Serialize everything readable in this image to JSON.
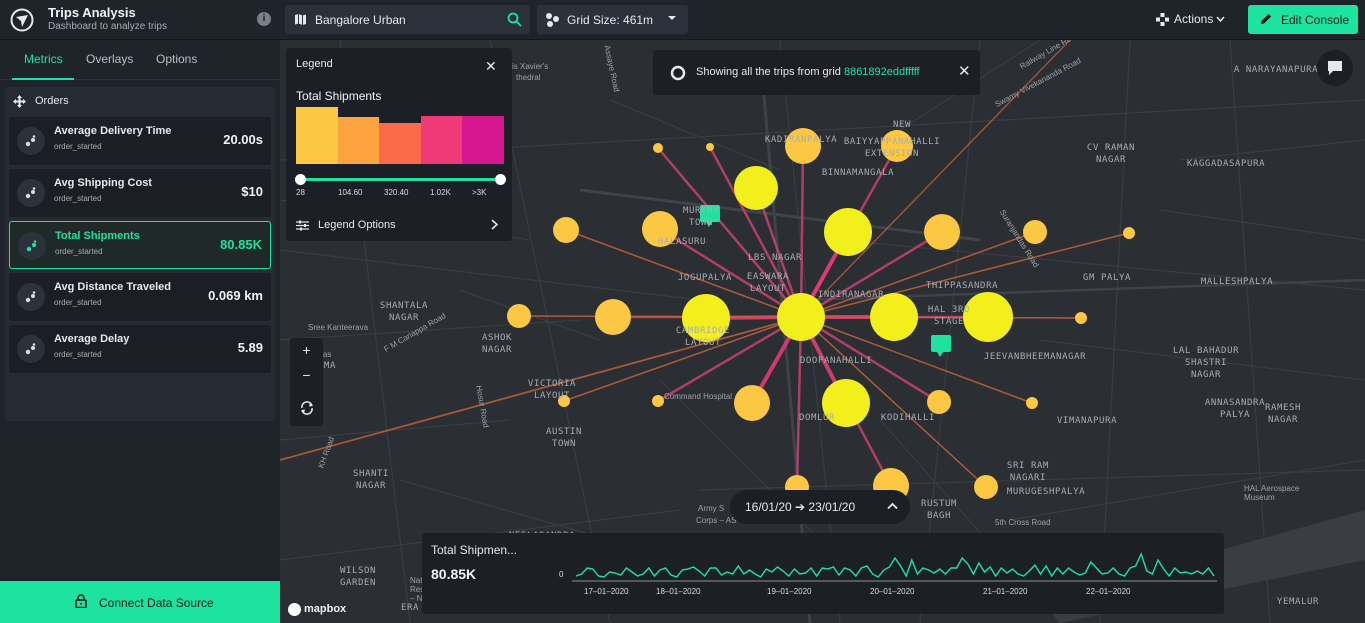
{
  "app": {
    "title": "Trips Analysis",
    "subtitle": "Dashboard to analyze trips",
    "info_icon": "info-icon"
  },
  "search": {
    "value": "Bangalore Urban",
    "placeholder": "Bangalore Urban"
  },
  "grid": {
    "label": "Grid Size: 461m"
  },
  "toolbar": {
    "actions_label": "Actions",
    "edit_console_label": "Edit Console"
  },
  "sidebar": {
    "tabs": [
      {
        "label": "Metrics",
        "active": true
      },
      {
        "label": "Overlays",
        "active": false
      },
      {
        "label": "Options",
        "active": false
      }
    ],
    "section_title": "Orders",
    "metrics": [
      {
        "name": "Average Delivery Time",
        "event": "order_started",
        "value": "20.00s",
        "active": false
      },
      {
        "name": "Avg Shipping Cost",
        "event": "order_started",
        "value": "$10",
        "active": false
      },
      {
        "name": "Total Shipments",
        "event": "order_started",
        "value": "80.85K",
        "active": true
      },
      {
        "name": "Avg Distance Traveled",
        "event": "order_started",
        "value": "0.069 km",
        "active": false
      },
      {
        "name": "Average Delay",
        "event": "order_started",
        "value": "5.89",
        "active": false
      }
    ],
    "connect_label": "Connect Data Source"
  },
  "legend": {
    "title": "Legend",
    "subtitle": "Total Shipments",
    "colors": [
      "#fcc742",
      "#fda33f",
      "#fb6a4a",
      "#f03a77",
      "#d6178f"
    ],
    "ticks": [
      "28",
      "104.60",
      "320.40",
      "1.02K",
      ">3K"
    ],
    "options_label": "Legend Options"
  },
  "banner": {
    "text": "Showing all the trips from grid ",
    "grid_id": "8861892eddfffff"
  },
  "date_range": "16/01/20 ➔ 23/01/20",
  "timeline": {
    "title": "Total Shipmen...",
    "value": "80.85K",
    "zero_label": "0",
    "ticks": [
      "17–01–2020",
      "18–01–2020",
      "19–01–2020",
      "20–01–2020",
      "21–01–2020",
      "22–01–2020"
    ]
  },
  "zoom": {
    "in": "+",
    "out": "−"
  },
  "attribution": "mapbox",
  "map": {
    "places": [
      {
        "t": "KADIRANPALYA"
      },
      {
        "t": "BAIYYAPPANAHALLI\nEXTENSION"
      },
      {
        "t": "NEW"
      },
      {
        "t": "BINNAMANGALA"
      },
      {
        "t": "CV RAMAN\nNAGAR"
      },
      {
        "t": "KAGGADASAPURA"
      },
      {
        "t": "A NARAYANAPURA"
      },
      {
        "t": "MURPHY\nTOWN"
      },
      {
        "t": "HALASURU"
      },
      {
        "t": "LBS NAGAR"
      },
      {
        "t": "JOGUPALYA"
      },
      {
        "t": "EASWARA\nLAYOUT"
      },
      {
        "t": "INDIRANAGAR"
      },
      {
        "t": "THIPPASANDRA"
      },
      {
        "t": "HAL 3RD\nSTAGE"
      },
      {
        "t": "GM PALYA"
      },
      {
        "t": "MALLESHPALYA"
      },
      {
        "t": "SHANTALA\nNAGAR"
      },
      {
        "t": "ASHOK\nNAGAR"
      },
      {
        "t": "CAMBRIDGE\nLAYOUT"
      },
      {
        "t": "DOOPANAHALLI"
      },
      {
        "t": "JEEVANBHEEMANAGAR"
      },
      {
        "t": "LAL BAHADUR\nSHASTRI\nNAGAR"
      },
      {
        "t": "VICTORIA\nLAYOUT"
      },
      {
        "t": "DOMLUR"
      },
      {
        "t": "KODIHALLI"
      },
      {
        "t": "VIMANAPURA"
      },
      {
        "t": "ANNASANDRA\nPALYA"
      },
      {
        "t": "RAMESH\nNAGAR"
      },
      {
        "t": "AUSTIN\nTOWN"
      },
      {
        "t": "SRI RAM\nNAGARI"
      },
      {
        "t": "MURUGESHPALYA"
      },
      {
        "t": "SHANTI\nNAGAR"
      },
      {
        "t": "RUSTUM\nBAGH"
      },
      {
        "t": "NEELASANDRA"
      },
      {
        "t": "WILSON\nGARDEN"
      },
      {
        "t": "YEMALUR"
      },
      {
        "t": "ERA"
      },
      {
        "t": "MAMA"
      }
    ],
    "roads": [
      "Assaye Road",
      "Railway Line Road",
      "Swamy Vivekananda Road",
      "Suranjandas Road",
      "Sree Kanteerava",
      "F M Cariappa Road",
      "Hosur Road",
      "KH Road",
      "Command Hospital",
      "Army S",
      "Corps – AS",
      "5th Cross Road",
      "HAL Aerospace\nMuseum",
      "cis Xavier's",
      "thedral",
      "Old Madras",
      "National Dairy\nResearch Institute\n– NDRI Adugodi",
      "EJIPURA"
    ]
  }
}
